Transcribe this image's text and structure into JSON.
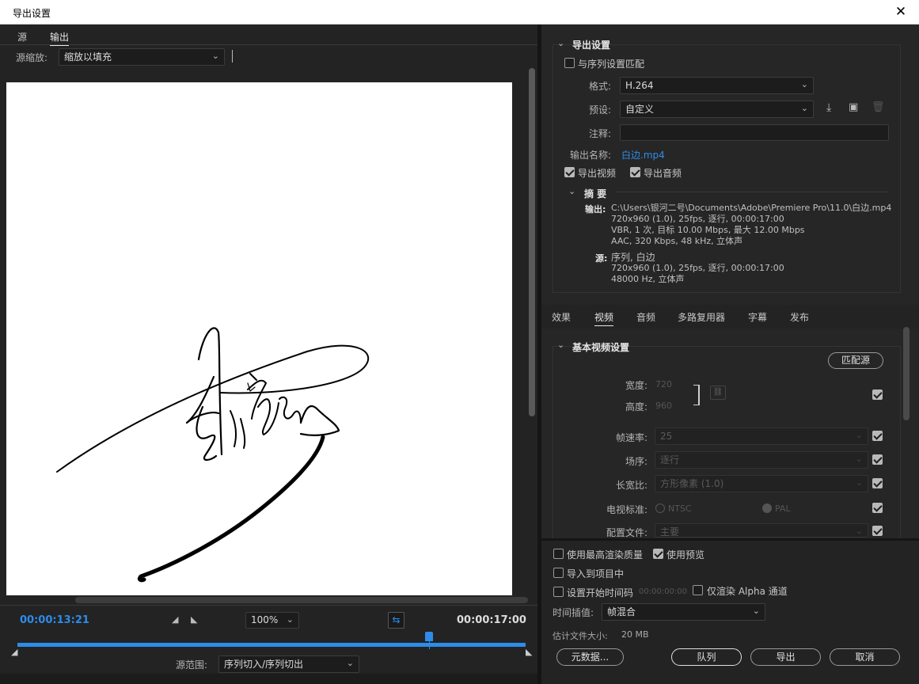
{
  "window": {
    "title": "导出设置",
    "close_glyph": "✕"
  },
  "left": {
    "tabs": [
      "源",
      "输出"
    ],
    "active_tab": "输出",
    "source_scale_label": "源缩放:",
    "source_scale_value": "缩放以填充",
    "timecode_current": "00:00:13:21",
    "timecode_total": "00:00:17:00",
    "zoom_value": "100%",
    "source_range_label": "源范围:",
    "source_range_value": "序列切入/序列切出",
    "playhead_fraction": 0.81
  },
  "export_settings": {
    "heading": "导出设置",
    "match_sequence_label": "与序列设置匹配",
    "match_sequence_checked": false,
    "format_label": "格式:",
    "format_value": "H.264",
    "preset_label": "预设:",
    "preset_value": "自定义",
    "comments_label": "注释:",
    "comments_value": "",
    "output_name_label": "输出名称:",
    "output_name_value": "白边.mp4",
    "export_video_label": "导出视频",
    "export_video_checked": true,
    "export_audio_label": "导出音频",
    "export_audio_checked": true,
    "summary_heading": "摘 要",
    "output_label": "输出:",
    "output_lines": [
      "C:\\Users\\银河二号\\Documents\\Adobe\\Premiere Pro\\11.0\\白边.mp4",
      "720x960 (1.0), 25fps, 逐行, 00:00:17:00",
      "VBR, 1 次, 目标 10.00 Mbps, 最大 12.00 Mbps",
      "AAC, 320 Kbps, 48 kHz, 立体声"
    ],
    "source_label": "源:",
    "source_lines": [
      "序列, 白边",
      "720x960 (1.0), 25fps, 逐行, 00:00:17:00",
      "48000 Hz, 立体声"
    ]
  },
  "tabs2": [
    "效果",
    "视频",
    "音频",
    "多路复用器",
    "字幕",
    "发布"
  ],
  "active_tab2": "视频",
  "basic_video": {
    "heading": "基本视频设置",
    "match_source_button": "匹配源",
    "width_label": "宽度:",
    "width_value": "720",
    "height_label": "高度:",
    "height_value": "960",
    "frame_rate_label": "帧速率:",
    "frame_rate_value": "25",
    "field_order_label": "场序:",
    "field_order_value": "逐行",
    "aspect_label": "长宽比:",
    "aspect_value": "方形像素 (1.0)",
    "tv_standard_label": "电视标准:",
    "ntsc_label": "NTSC",
    "pal_label": "PAL",
    "profile_label": "配置文件:",
    "profile_value": "主要"
  },
  "bottom": {
    "max_render_label": "使用最高渲染质量",
    "max_render_checked": false,
    "use_previews_label": "使用预览",
    "use_previews_checked": true,
    "import_project_label": "导入到项目中",
    "import_project_checked": false,
    "set_start_tc_label": "设置开始时间码",
    "start_tc_value": "00:00:00:00",
    "alpha_only_label": "仅渲染 Alpha 通道",
    "time_interp_label": "时间插值:",
    "time_interp_value": "帧混合",
    "est_size_label": "估计文件大小:",
    "est_size_value": "20 MB",
    "metadata_button": "元数据...",
    "queue_button": "队列",
    "export_button": "导出",
    "cancel_button": "取消"
  }
}
